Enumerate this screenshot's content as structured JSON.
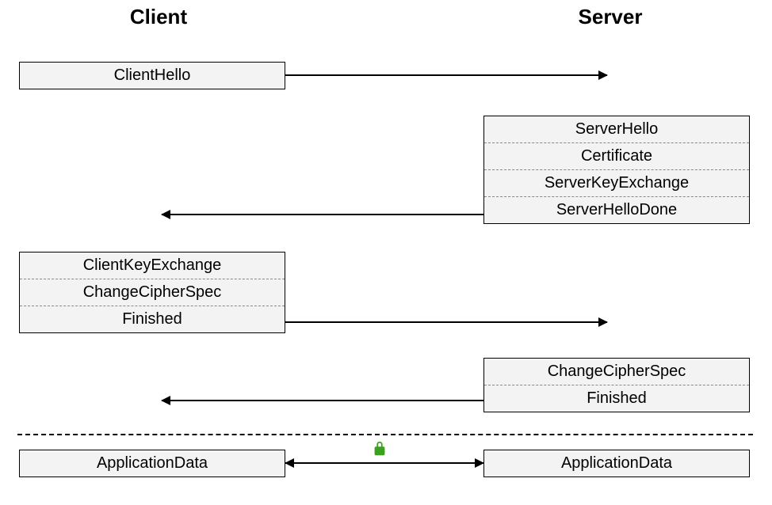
{
  "headings": {
    "client": "Client",
    "server": "Server"
  },
  "messages": {
    "group1": [
      "ClientHello"
    ],
    "group2": [
      "ServerHello",
      "Certificate",
      "ServerKeyExchange",
      "ServerHelloDone"
    ],
    "group3": [
      "ClientKeyExchange",
      "ChangeCipherSpec",
      "Finished"
    ],
    "group4": [
      "ChangeCipherSpec",
      "Finished"
    ],
    "group5_client": [
      "ApplicationData"
    ],
    "group5_server": [
      "ApplicationData"
    ]
  },
  "icons": {
    "lock": "lock-icon"
  }
}
